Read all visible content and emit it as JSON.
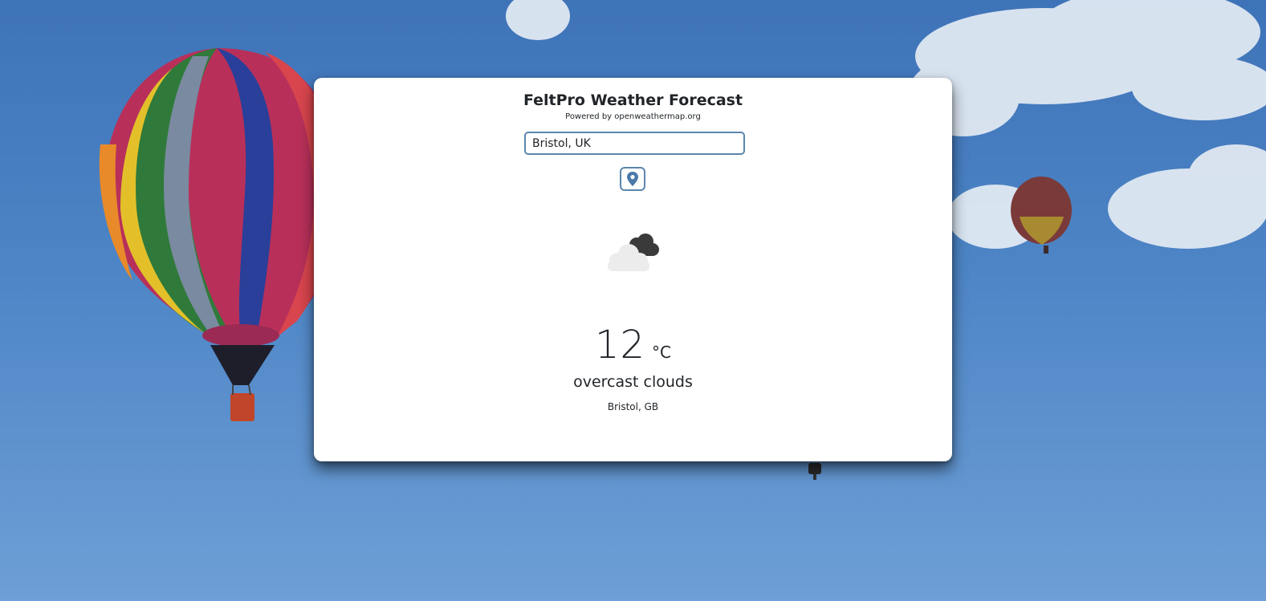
{
  "header": {
    "title": "FeltPro Weather Forecast",
    "subtitle": "Powered by openweathermap.org"
  },
  "search": {
    "value": "Bristol, UK"
  },
  "location_button": {
    "icon": "map-pin-icon"
  },
  "weather": {
    "icon": "overcast-clouds-icon",
    "temperature": "12",
    "unit": "°C",
    "description": "overcast clouds",
    "location": "Bristol, GB"
  },
  "background": {
    "icon": "hot-air-balloons-sky-image"
  },
  "colors": {
    "accent": "#5b86ad",
    "text": "#212529",
    "sky": "#4d85c6"
  }
}
